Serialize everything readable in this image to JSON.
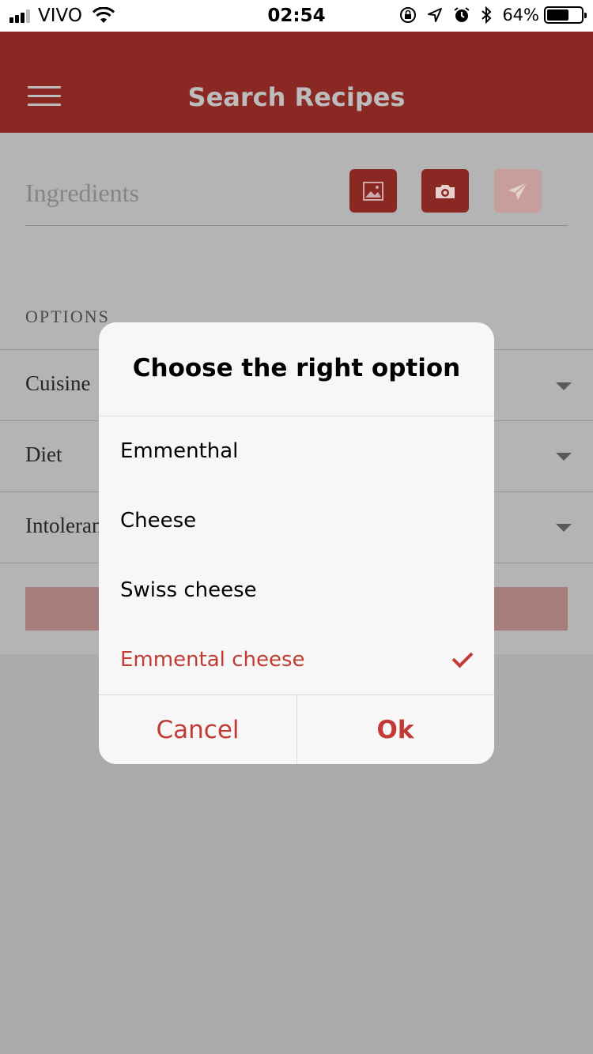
{
  "status_bar": {
    "carrier": "VIVO",
    "time": "02:54",
    "battery_percent": "64%",
    "battery_level": 0.64,
    "icons": [
      "signal-icon",
      "wifi-icon",
      "rotation-lock-icon",
      "location-icon",
      "alarm-icon",
      "bluetooth-icon",
      "battery-icon"
    ]
  },
  "header": {
    "title": "Search Recipes",
    "menu_icon": "hamburger-menu-icon",
    "color": "#8a2824"
  },
  "search": {
    "placeholder": "Ingredients",
    "buttons": [
      {
        "icon": "image-icon"
      },
      {
        "icon": "camera-icon"
      },
      {
        "icon": "send-icon"
      }
    ]
  },
  "options": {
    "title": "OPTIONS",
    "rows": [
      {
        "label": "Cuisine"
      },
      {
        "label": "Diet"
      },
      {
        "label": "Intoleran"
      }
    ]
  },
  "dialog": {
    "title": "Choose the right option",
    "items": [
      {
        "label": "Emmenthal",
        "selected": false
      },
      {
        "label": "Cheese",
        "selected": false
      },
      {
        "label": "Swiss cheese",
        "selected": false
      },
      {
        "label": "Emmental cheese",
        "selected": true
      }
    ],
    "cancel_label": "Cancel",
    "ok_label": "Ok",
    "accent_color": "#c23b35"
  }
}
